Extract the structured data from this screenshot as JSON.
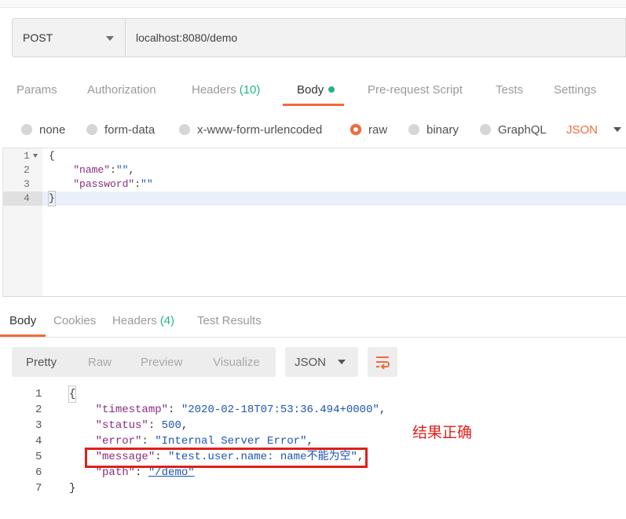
{
  "request": {
    "method": "POST",
    "url": "localhost:8080/demo"
  },
  "request_tabs": {
    "params": "Params",
    "authorization": "Authorization",
    "headers": "Headers",
    "headers_count": "(10)",
    "body": "Body",
    "pre_request_script": "Pre-request Script",
    "tests": "Tests",
    "settings": "Settings"
  },
  "body_types": {
    "none": "none",
    "form_data": "form-data",
    "urlencoded": "x-www-form-urlencoded",
    "raw": "raw",
    "binary": "binary",
    "graphql": "GraphQL",
    "format": "JSON",
    "selected": "raw"
  },
  "request_body": {
    "lines": [
      {
        "num": "1",
        "text": "{"
      },
      {
        "num": "2",
        "key": "\"name\"",
        "sep": ":",
        "val": "\"\"",
        "tail": ","
      },
      {
        "num": "3",
        "key": "\"password\"",
        "sep": ":",
        "val": "\"\"",
        "tail": ""
      },
      {
        "num": "4",
        "text": "}"
      }
    ]
  },
  "response_tabs": {
    "body": "Body",
    "cookies": "Cookies",
    "headers": "Headers",
    "headers_count": "(4)",
    "test_results": "Test Results"
  },
  "response_toolbar": {
    "pretty": "Pretty",
    "raw": "Raw",
    "preview": "Preview",
    "visualize": "Visualize",
    "format": "JSON"
  },
  "response_body": {
    "lines": [
      {
        "num": "1",
        "text": "{"
      },
      {
        "num": "2",
        "key": "\"timestamp\"",
        "val": "\"2020-02-18T07:53:36.494+0000\""
      },
      {
        "num": "3",
        "key": "\"status\"",
        "val": "500"
      },
      {
        "num": "4",
        "key": "\"error\"",
        "val": "\"Internal Server Error\""
      },
      {
        "num": "5",
        "key": "\"message\"",
        "val": "\"test.user.name: name不能为空\""
      },
      {
        "num": "6",
        "key": "\"path\"",
        "val": "\"/demo\""
      },
      {
        "num": "7",
        "text": "}"
      }
    ]
  },
  "annotation": "结果正确",
  "colors": {
    "accent": "#f26b3a",
    "active_dot": "#26b47f",
    "highlight": "#e0201b"
  }
}
